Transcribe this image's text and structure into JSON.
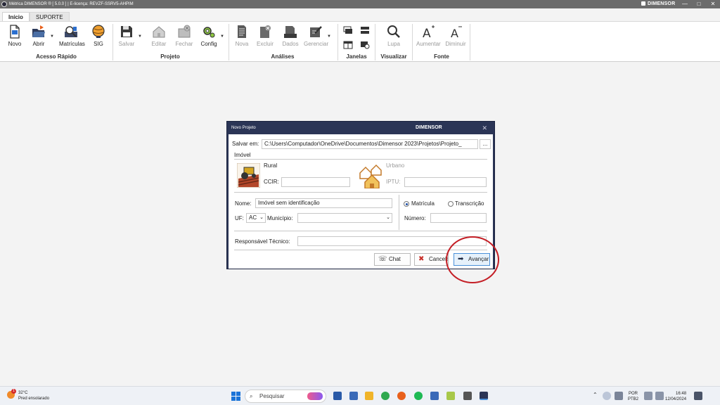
{
  "window": {
    "title": "Métrica DIMENSOR ® [ 5.0.0 ] | E-licença: REVZF-SSRV5-AHPIM",
    "brand": "DIMENSOR",
    "controls": [
      "—",
      "□",
      "✕"
    ]
  },
  "tabs": [
    {
      "label": "Início",
      "active": true
    },
    {
      "label": "SUPORTE",
      "active": false
    }
  ],
  "ribbon": {
    "groups": {
      "acesso_rapido": "Acesso Rápido",
      "projeto": "Projeto",
      "analises": "Análises",
      "janelas": "Janelas",
      "visualizar": "Visualizar",
      "fonte": "Fonte"
    },
    "buttons": {
      "novo": "Novo",
      "abrir": "Abrir",
      "matriculas": "Matrículas",
      "sig": "SIG",
      "salvar": "Salvar",
      "editar": "Editar",
      "fechar": "Fechar",
      "config": "Config",
      "nova": "Nova",
      "excluir": "Excluir",
      "dados": "Dados",
      "gerenciar": "Gerenciar",
      "lupa": "Lupa",
      "aumentar": "Aumentar",
      "diminuir": "Diminuir"
    }
  },
  "dialog": {
    "title": "Novo Projeto",
    "brand": "DIMENSOR",
    "close": "✕",
    "salvar_em_label": "Salvar em:",
    "salvar_em_value": "C:\\Users\\Computador\\OneDrive\\Documentos\\Dimensor 2023\\Projetos\\Projeto_",
    "browse": "...",
    "imovel_label": "Imóvel",
    "rural_label": "Rural",
    "ccir_label": "CCIR:",
    "ccir_value": "",
    "urbano_label": "Urbano",
    "iptu_label": "IPTU:",
    "iptu_value": "",
    "nome_label": "Nome:",
    "nome_value": "Imóvel sem identificação",
    "uf_label": "UF:",
    "uf_value": "AC",
    "municipio_label": "Município:",
    "municipio_value": "",
    "matricula_label": "Matrícula",
    "transcricao_label": "Transcrição",
    "selected_registro": "Matrícula",
    "numero_label": "Número:",
    "numero_value": "",
    "responsavel_label": "Responsável Técnico:",
    "responsavel_value": "",
    "chat_button": "Chat",
    "cancel_button": "Cancelar",
    "next_button": "Avançar"
  },
  "taskbar": {
    "weather_temp": "32°C",
    "weather_desc": "Pred ensolarado",
    "search_placeholder": "Pesquisar",
    "lang_top": "POR",
    "lang_bottom": "PTB2",
    "time": "16:48",
    "date": "12/04/2024",
    "notification_count": "1"
  },
  "colors": {
    "dialog_frame": "#2b3556",
    "highlight": "#c41e25",
    "primary_button": "#4a90d9"
  }
}
